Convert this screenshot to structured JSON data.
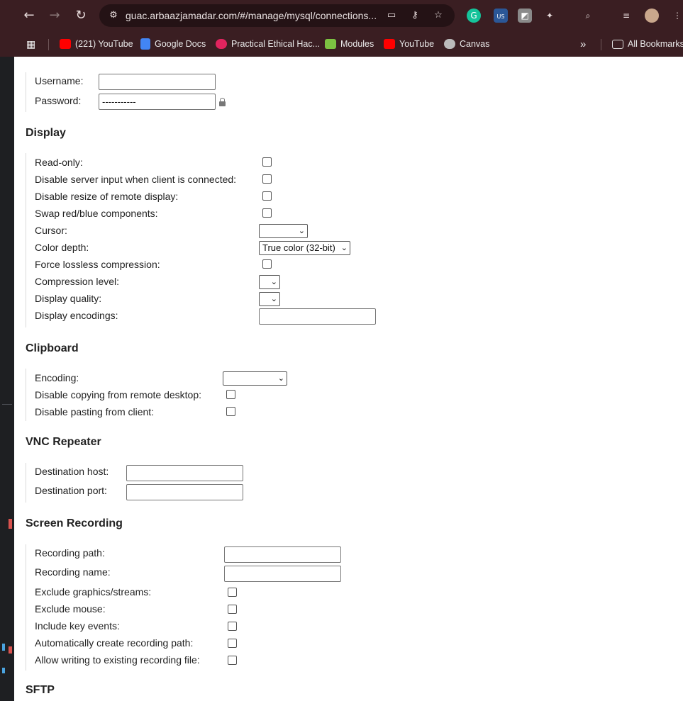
{
  "browser": {
    "url": "guac.arbaazjamadar.com/#/manage/mysql/connections...",
    "extension_badge": "US",
    "bookmarks": [
      {
        "label": "(221) YouTube",
        "icon": "youtube-icon",
        "color": "#ff0000"
      },
      {
        "label": "Google Docs",
        "icon": "google-docs-icon",
        "color": "#4285f4"
      },
      {
        "label": "Practical Ethical Hac...",
        "icon": "tcm-icon",
        "color": "#e0245e"
      },
      {
        "label": "Modules",
        "icon": "cube-icon",
        "color": "#7cc242"
      },
      {
        "label": "YouTube",
        "icon": "youtube-icon",
        "color": "#ff0000"
      },
      {
        "label": "Canvas",
        "icon": "globe-icon",
        "color": "#bbbbbb"
      }
    ],
    "overflow_label": "»",
    "all_bookmarks": "All Bookmarks"
  },
  "auth": {
    "username_label": "Username:",
    "password_label": "Password:",
    "username_value": "",
    "password_value": "-----------"
  },
  "display": {
    "title": "Display",
    "read_only": "Read-only:",
    "disable_server_input": "Disable server input when client is connected:",
    "disable_resize": "Disable resize of remote display:",
    "swap_red_blue": "Swap red/blue components:",
    "cursor": "Cursor:",
    "cursor_value": "",
    "color_depth": "Color depth:",
    "color_depth_value": "True color (32-bit)",
    "force_lossless": "Force lossless compression:",
    "compression_level": "Compression level:",
    "display_quality": "Display quality:",
    "display_encodings": "Display encodings:"
  },
  "clipboard": {
    "title": "Clipboard",
    "encoding": "Encoding:",
    "encoding_value": "",
    "disable_copy": "Disable copying from remote desktop:",
    "disable_paste": "Disable pasting from client:"
  },
  "vnc_repeater": {
    "title": "VNC Repeater",
    "dest_host": "Destination host:",
    "dest_port": "Destination port:"
  },
  "recording": {
    "title": "Screen Recording",
    "path": "Recording path:",
    "name": "Recording name:",
    "exclude_graphics": "Exclude graphics/streams:",
    "exclude_mouse": "Exclude mouse:",
    "include_keys": "Include key events:",
    "auto_create": "Automatically create recording path:",
    "allow_writing": "Allow writing to existing recording file:"
  },
  "sftp": {
    "title": "SFTP"
  },
  "colors": {
    "chrome_bg": "#3a1e22",
    "omnibox_bg": "#241215"
  }
}
